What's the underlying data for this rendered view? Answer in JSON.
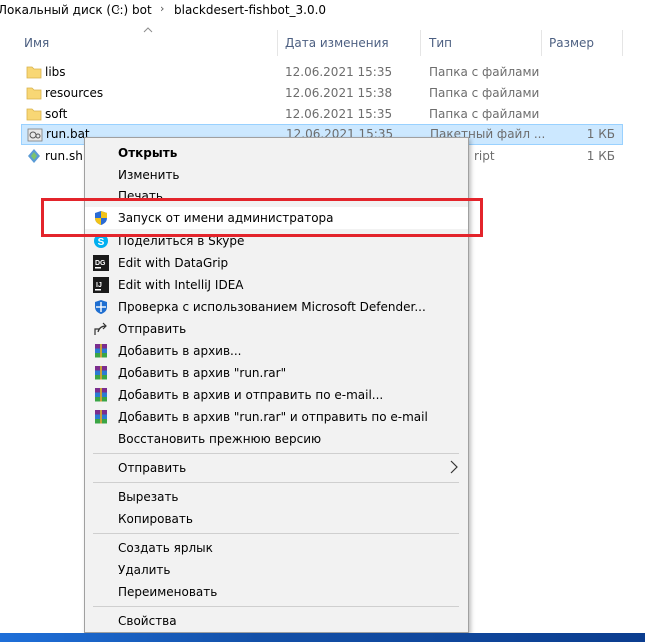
{
  "breadcrumb": {
    "items": [
      "Локальный диск (C:)",
      "bot",
      "blackdesert-fishbot_3.0.0"
    ]
  },
  "columns": {
    "name": "Имя",
    "date": "Дата изменения",
    "type": "Тип",
    "size": "Размер"
  },
  "files": [
    {
      "name": "libs",
      "date": "12.06.2021 15:35",
      "type": "Папка с файлами",
      "size": "",
      "icon": "folder-icon"
    },
    {
      "name": "resources",
      "date": "12.06.2021 15:38",
      "type": "Папка с файлами",
      "size": "",
      "icon": "folder-icon"
    },
    {
      "name": "soft",
      "date": "12.06.2021 15:35",
      "type": "Папка с файлами",
      "size": "",
      "icon": "folder-icon"
    },
    {
      "name": "run.bat",
      "date": "12.06.2021 15:35",
      "type": "Пакетный файл ...",
      "size": "1 КБ",
      "icon": "batch-file-icon",
      "selected": true
    },
    {
      "name": "run.sh",
      "date": "",
      "type": "ript",
      "size": "1 КБ",
      "icon": "shell-script-icon"
    }
  ],
  "context_menu": {
    "items": [
      {
        "label": "Открыть",
        "bold": true,
        "icon": ""
      },
      {
        "label": "Изменить",
        "icon": ""
      },
      {
        "label": "Печать",
        "icon": ""
      },
      {
        "label": "Запуск от имени администратора",
        "icon": "uac-shield-icon",
        "highlighted": true
      },
      {
        "label": "Поделиться в Skype",
        "icon": "skype-icon"
      },
      {
        "label": "Edit with DataGrip",
        "icon": "datagrip-icon"
      },
      {
        "label": "Edit with IntelliJ IDEA",
        "icon": "intellij-icon"
      },
      {
        "label": "Проверка с использованием Microsoft Defender...",
        "icon": "defender-icon"
      },
      {
        "label": "Отправить",
        "icon": "share-icon"
      },
      {
        "label": "Добавить в архив...",
        "icon": "winrar-icon"
      },
      {
        "label": "Добавить в архив \"run.rar\"",
        "icon": "winrar-icon"
      },
      {
        "label": "Добавить в архив и отправить по e-mail...",
        "icon": "winrar-icon"
      },
      {
        "label": "Добавить в архив \"run.rar\" и отправить по e-mail",
        "icon": "winrar-icon"
      },
      {
        "label": "Восстановить прежнюю версию",
        "icon": ""
      },
      {
        "label": "Отправить",
        "icon": "",
        "submenu": true
      },
      {
        "label": "Вырезать",
        "icon": ""
      },
      {
        "label": "Копировать",
        "icon": ""
      },
      {
        "label": "Создать ярлык",
        "icon": ""
      },
      {
        "label": "Удалить",
        "icon": ""
      },
      {
        "label": "Переименовать",
        "icon": ""
      },
      {
        "label": "Свойства",
        "icon": ""
      }
    ]
  },
  "colors": {
    "highlight_box": "#e3242b",
    "selection": "#cce8ff",
    "header_text": "#4d6082"
  }
}
